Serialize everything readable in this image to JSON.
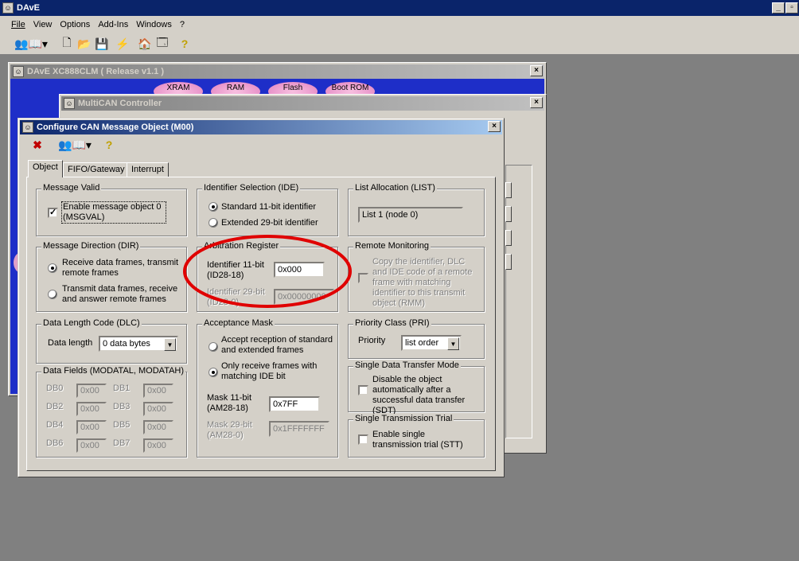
{
  "app": {
    "title": "DAvE",
    "menu": [
      "File",
      "View",
      "Options",
      "Add-Ins",
      "Windows",
      "?"
    ]
  },
  "win1": {
    "title": "DAvE XC888CLM ( Release v1.1 )",
    "buttons": [
      "XRAM",
      "RAM",
      "Flash",
      "Boot ROM"
    ]
  },
  "win2": {
    "title": "MultiCAN Controller"
  },
  "dialog": {
    "title": "Configure CAN Message Object (M00)",
    "tabs": [
      "Object",
      "FIFO/Gateway",
      "Interrupt"
    ],
    "message_valid": {
      "title": "Message Valid",
      "label": "Enable message object 0 (MSGVAL)",
      "checked": true
    },
    "ide": {
      "title": "Identifier Selection (IDE)",
      "opt1": "Standard 11-bit identifier",
      "opt2": "Extended 29-bit identifier"
    },
    "list": {
      "title": "List Allocation (LIST)",
      "value": "List 1 (node 0)"
    },
    "dir": {
      "title": "Message Direction (DIR)",
      "opt1": "Receive data frames, transmit remote frames",
      "opt2": "Transmit data frames, receive and answer remote frames"
    },
    "arb": {
      "title": "Arbitration Register",
      "id11_label": "Identifier 11-bit (ID28-18)",
      "id11_value": "0x000",
      "id29_label": "Identifier 29-bit (ID28-0)",
      "id29_value": "0x00000000"
    },
    "rmm": {
      "title": "Remote Monitoring",
      "label": "Copy the identifier, DLC and IDE code of a remote frame with matching identifier to this transmit object (RMM)"
    },
    "dlc": {
      "title": "Data Length Code (DLC)",
      "label": "Data length",
      "value": "0 data bytes"
    },
    "mask": {
      "title": "Acceptance Mask",
      "opt1": "Accept reception of standard and extended frames",
      "opt2": "Only receive frames with matching IDE bit",
      "m11_label": "Mask 11-bit (AM28-18)",
      "m11_value": "0x7FF",
      "m29_label": "Mask 29-bit (AM28-0)",
      "m29_value": "0x1FFFFFFF"
    },
    "pri": {
      "title": "Priority Class (PRI)",
      "label": "Priority",
      "value": "list order"
    },
    "sdt": {
      "title": "Single Data Transfer Mode",
      "label": "Disable the object automatically after a successful data transfer (SDT)"
    },
    "stt": {
      "title": "Single Transmission Trial",
      "label": "Enable single transmission trial (STT)"
    },
    "fields": {
      "title": "Data Fields (MODATAL, MODATAH)",
      "db": [
        {
          "n": "DB0",
          "v": "0x00"
        },
        {
          "n": "DB1",
          "v": "0x00"
        },
        {
          "n": "DB2",
          "v": "0x00"
        },
        {
          "n": "DB3",
          "v": "0x00"
        },
        {
          "n": "DB4",
          "v": "0x00"
        },
        {
          "n": "DB5",
          "v": "0x00"
        },
        {
          "n": "DB6",
          "v": "0x00"
        },
        {
          "n": "DB7",
          "v": "0x00"
        }
      ]
    }
  }
}
